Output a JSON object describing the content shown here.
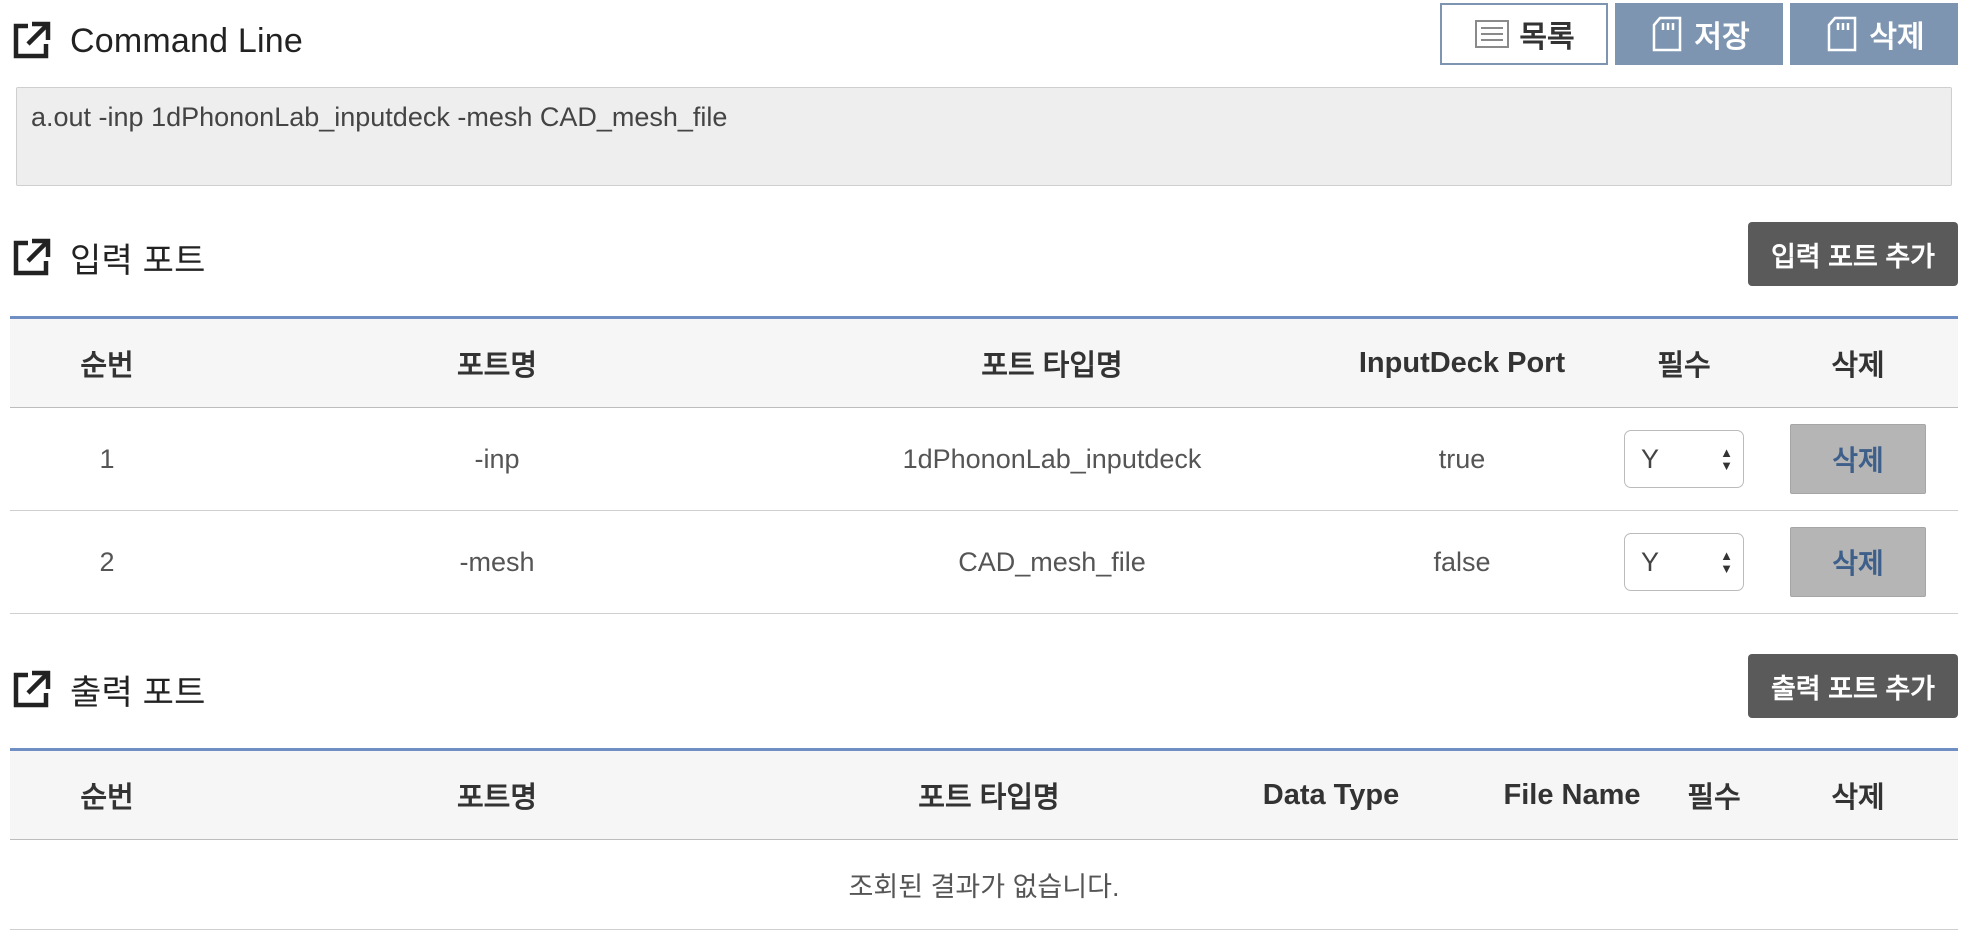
{
  "command_line": {
    "title": "Command Line",
    "value": "a.out -inp 1dPhononLab_inputdeck -mesh CAD_mesh_file"
  },
  "toolbar": {
    "list_label": "목록",
    "save_label": "저장",
    "delete_label": "삭제"
  },
  "input_ports": {
    "title": "입력 포트",
    "add_label": "입력 포트 추가",
    "headers": {
      "no": "순번",
      "port_name": "포트명",
      "port_type": "포트 타입명",
      "inputdeck": "InputDeck Port",
      "required": "필수",
      "delete": "삭제"
    },
    "rows": [
      {
        "no": "1",
        "port_name": "-inp",
        "port_type": "1dPhononLab_inputdeck",
        "inputdeck": "true",
        "required": "Y",
        "delete_label": "삭제"
      },
      {
        "no": "2",
        "port_name": "-mesh",
        "port_type": "CAD_mesh_file",
        "inputdeck": "false",
        "required": "Y",
        "delete_label": "삭제"
      }
    ]
  },
  "output_ports": {
    "title": "출력 포트",
    "add_label": "출력 포트 추가",
    "headers": {
      "no": "순번",
      "port_name": "포트명",
      "port_type": "포트 타입명",
      "data_type": "Data Type",
      "file_name": "File Name",
      "required": "필수",
      "delete": "삭제"
    },
    "empty_message": "조회된 결과가 없습니다."
  },
  "colors": {
    "accent_blue": "#6f8ec4",
    "toolbar_button": "#7e95b2",
    "dark_button": "#5a5a5a",
    "row_delete_bg": "#b5b5b5",
    "row_delete_text": "#3d5f8a"
  },
  "icons": {
    "section_icon": "external-link-icon",
    "list_icon": "list-icon",
    "save_icon": "sd-card-icon",
    "delete_icon": "sd-card-icon"
  }
}
